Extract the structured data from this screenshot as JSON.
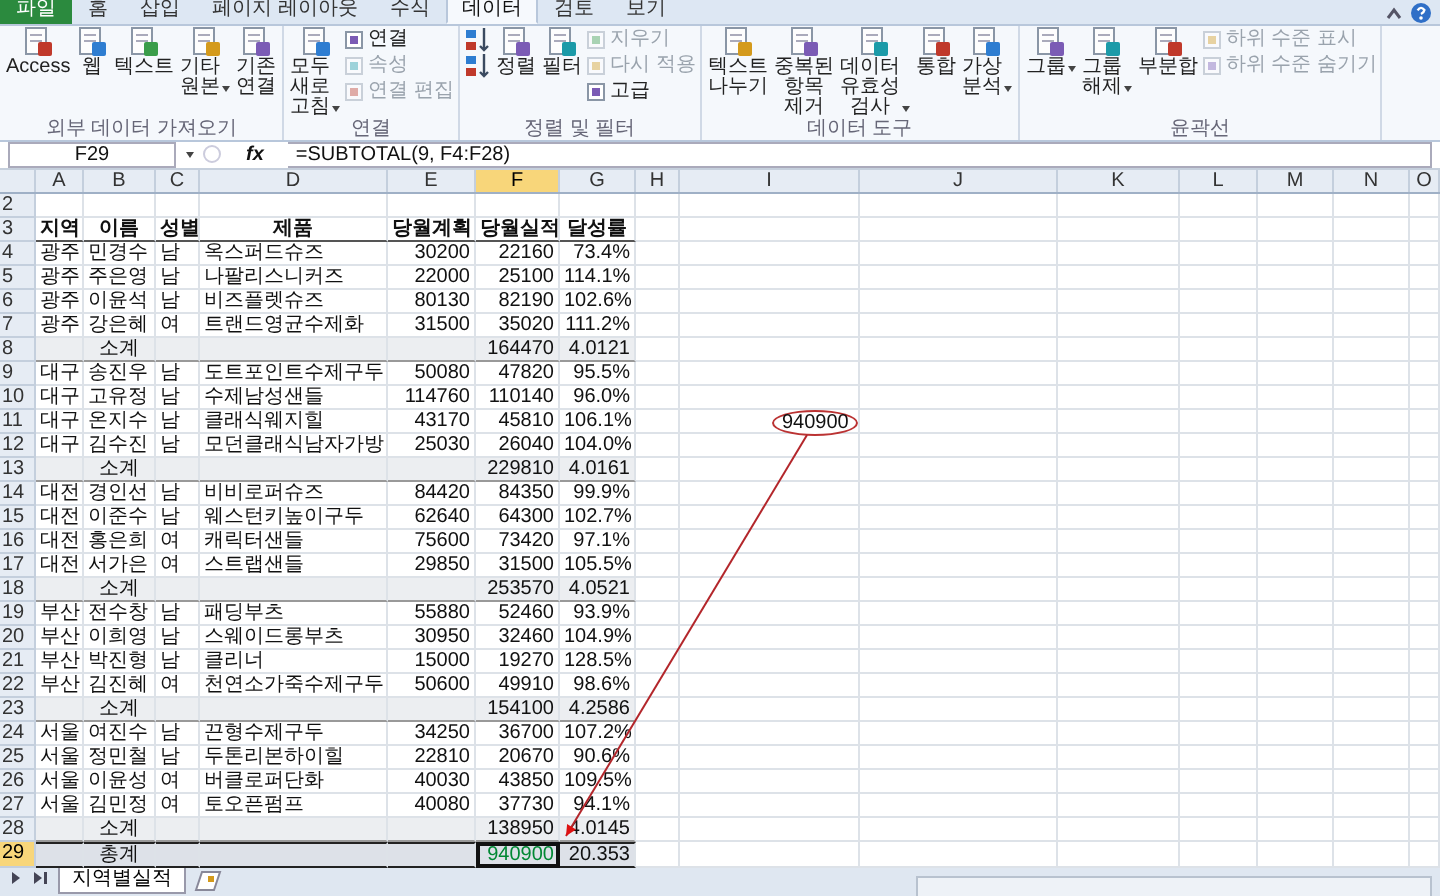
{
  "ribbon_tabs": [
    {
      "label": "파일",
      "kind": "file",
      "selected": false
    },
    {
      "label": "홈",
      "kind": "tab",
      "selected": false
    },
    {
      "label": "삽입",
      "kind": "tab",
      "selected": false
    },
    {
      "label": "페이지 레이아웃",
      "kind": "tab",
      "selected": false
    },
    {
      "label": "수식",
      "kind": "tab",
      "selected": false
    },
    {
      "label": "데이터",
      "kind": "tab",
      "selected": true
    },
    {
      "label": "검토",
      "kind": "tab",
      "selected": false
    },
    {
      "label": "보기",
      "kind": "tab",
      "selected": false
    }
  ],
  "ribbon_groups": [
    {
      "label": "외부 데이터 가져오기",
      "buttons": [
        {
          "label": "Access",
          "kind": "large",
          "dropdown": false,
          "disabled": false
        },
        {
          "label": "웹",
          "kind": "large",
          "dropdown": false,
          "disabled": false
        },
        {
          "label": "텍스트",
          "kind": "large",
          "dropdown": false,
          "disabled": false
        },
        {
          "label": "기타 원본",
          "kind": "large",
          "dropdown": true,
          "disabled": false
        },
        {
          "label": "기존 연결",
          "kind": "large",
          "dropdown": false,
          "disabled": false
        }
      ]
    },
    {
      "label": "연결",
      "buttons": [
        {
          "label": "모두 새로 고침",
          "kind": "large",
          "dropdown": true,
          "disabled": false
        },
        {
          "label": "연결",
          "kind": "small",
          "dropdown": false,
          "disabled": false
        },
        {
          "label": "속성",
          "kind": "small",
          "dropdown": false,
          "disabled": true
        },
        {
          "label": "연결 편집",
          "kind": "small",
          "dropdown": false,
          "disabled": true
        }
      ]
    },
    {
      "label": "정렬 및 필터",
      "buttons": [
        {
          "kind": "sort",
          "dropdown": false,
          "disabled": false
        },
        {
          "kind": "sort",
          "dropdown": false,
          "disabled": false
        },
        {
          "label": "정렬",
          "kind": "large",
          "dropdown": false,
          "disabled": false
        },
        {
          "label": "필터",
          "kind": "large",
          "dropdown": false,
          "disabled": false
        },
        {
          "label": "지우기",
          "kind": "small",
          "dropdown": false,
          "disabled": true
        },
        {
          "label": "다시 적용",
          "kind": "small",
          "dropdown": false,
          "disabled": true
        },
        {
          "label": "고급",
          "kind": "small",
          "dropdown": false,
          "disabled": false
        }
      ]
    },
    {
      "label": "데이터 도구",
      "buttons": [
        {
          "label": "텍스트 나누기",
          "kind": "large",
          "dropdown": false,
          "disabled": false
        },
        {
          "label": "중복된 항목 제거",
          "kind": "large",
          "dropdown": false,
          "disabled": false
        },
        {
          "label": "데이터 유효성 검사",
          "kind": "large",
          "dropdown": true,
          "disabled": false
        },
        {
          "label": "통합",
          "kind": "large",
          "dropdown": false,
          "disabled": false
        },
        {
          "label": "가상 분석",
          "kind": "large",
          "dropdown": true,
          "disabled": false
        }
      ]
    },
    {
      "label": "윤곽선",
      "buttons": [
        {
          "label": "그룹",
          "kind": "large",
          "dropdown": true,
          "disabled": false
        },
        {
          "label": "그룹 해제",
          "kind": "large",
          "dropdown": true,
          "disabled": false
        },
        {
          "label": "부분합",
          "kind": "large",
          "dropdown": false,
          "disabled": false
        },
        {
          "label": "하위 수준 표시",
          "kind": "small",
          "dropdown": false,
          "disabled": true
        },
        {
          "label": "하위 수준 숨기기",
          "kind": "small",
          "dropdown": false,
          "disabled": true
        }
      ]
    }
  ],
  "name_box": "F29",
  "function_label": "fx",
  "formula": "=SUBTOTAL(9, F4:F28)",
  "columns": [
    {
      "label": "A",
      "selected": false
    },
    {
      "label": "B",
      "selected": false
    },
    {
      "label": "C",
      "selected": false
    },
    {
      "label": "D",
      "selected": false
    },
    {
      "label": "E",
      "selected": false
    },
    {
      "label": "F",
      "selected": true
    },
    {
      "label": "G",
      "selected": false
    },
    {
      "label": "H",
      "selected": false
    },
    {
      "label": "I",
      "selected": false
    },
    {
      "label": "J",
      "selected": false
    },
    {
      "label": "K",
      "selected": false
    },
    {
      "label": "L",
      "selected": false
    },
    {
      "label": "M",
      "selected": false
    },
    {
      "label": "N",
      "selected": false
    },
    {
      "label": "O",
      "selected": false
    }
  ],
  "rows": [
    {
      "number": "2",
      "kind": "empty",
      "selected": false
    },
    {
      "number": "3",
      "kind": "header",
      "selected": false,
      "cells": [
        "지역",
        "이름",
        "성별",
        "제품",
        "당월계획",
        "당월실적",
        "달성률"
      ]
    },
    {
      "number": "4",
      "kind": "data",
      "selected": false,
      "cells": [
        "광주",
        "민경수",
        "남",
        "옥스퍼드슈즈",
        "30200",
        "22160",
        "73.4%"
      ]
    },
    {
      "number": "5",
      "kind": "data",
      "selected": false,
      "cells": [
        "광주",
        "주은영",
        "남",
        "나팔리스니커즈",
        "22000",
        "25100",
        "114.1%"
      ]
    },
    {
      "number": "6",
      "kind": "data",
      "selected": false,
      "cells": [
        "광주",
        "이윤석",
        "남",
        "비즈플렛슈즈",
        "80130",
        "82190",
        "102.6%"
      ]
    },
    {
      "number": "7",
      "kind": "data",
      "selected": false,
      "cells": [
        "광주",
        "강은혜",
        "여",
        "트랜드영균수제화",
        "31500",
        "35020",
        "111.2%"
      ]
    },
    {
      "number": "8",
      "kind": "subtotal",
      "selected": false,
      "label": "소계",
      "total": "164470",
      "rate": "4.0121"
    },
    {
      "number": "9",
      "kind": "data",
      "selected": false,
      "cells": [
        "대구",
        "송진우",
        "남",
        "도트포인트수제구두",
        "50080",
        "47820",
        "95.5%"
      ]
    },
    {
      "number": "10",
      "kind": "data",
      "selected": false,
      "cells": [
        "대구",
        "고유정",
        "남",
        "수제남성샌들",
        "114760",
        "110140",
        "96.0%"
      ]
    },
    {
      "number": "11",
      "kind": "data",
      "selected": false,
      "cells": [
        "대구",
        "온지수",
        "남",
        "클래식웨지힐",
        "43170",
        "45810",
        "106.1%"
      ]
    },
    {
      "number": "12",
      "kind": "data",
      "selected": false,
      "cells": [
        "대구",
        "김수진",
        "남",
        "모던클래식남자가방",
        "25030",
        "26040",
        "104.0%"
      ]
    },
    {
      "number": "13",
      "kind": "subtotal",
      "selected": false,
      "label": "소계",
      "total": "229810",
      "rate": "4.0161"
    },
    {
      "number": "14",
      "kind": "data",
      "selected": false,
      "cells": [
        "대전",
        "경인선",
        "남",
        "비비로퍼슈즈",
        "84420",
        "84350",
        "99.9%"
      ]
    },
    {
      "number": "15",
      "kind": "data",
      "selected": false,
      "cells": [
        "대전",
        "이준수",
        "남",
        "웨스턴키높이구두",
        "62640",
        "64300",
        "102.7%"
      ]
    },
    {
      "number": "16",
      "kind": "data",
      "selected": false,
      "cells": [
        "대전",
        "홍은희",
        "여",
        "캐릭터샌들",
        "75600",
        "73420",
        "97.1%"
      ]
    },
    {
      "number": "17",
      "kind": "data",
      "selected": false,
      "cells": [
        "대전",
        "서가은",
        "여",
        "스트랩샌들",
        "29850",
        "31500",
        "105.5%"
      ]
    },
    {
      "number": "18",
      "kind": "subtotal",
      "selected": false,
      "label": "소계",
      "total": "253570",
      "rate": "4.0521"
    },
    {
      "number": "19",
      "kind": "data",
      "selected": false,
      "cells": [
        "부산",
        "전수창",
        "남",
        "패딩부츠",
        "55880",
        "52460",
        "93.9%"
      ]
    },
    {
      "number": "20",
      "kind": "data",
      "selected": false,
      "cells": [
        "부산",
        "이희영",
        "남",
        "스웨이드롱부츠",
        "30950",
        "32460",
        "104.9%"
      ]
    },
    {
      "number": "21",
      "kind": "data",
      "selected": false,
      "cells": [
        "부산",
        "박진형",
        "남",
        "클리너",
        "15000",
        "19270",
        "128.5%"
      ]
    },
    {
      "number": "22",
      "kind": "data",
      "selected": false,
      "cells": [
        "부산",
        "김진혜",
        "여",
        "천연소가죽수제구두",
        "50600",
        "49910",
        "98.6%"
      ]
    },
    {
      "number": "23",
      "kind": "subtotal",
      "selected": false,
      "label": "소계",
      "total": "154100",
      "rate": "4.2586"
    },
    {
      "number": "24",
      "kind": "data",
      "selected": false,
      "cells": [
        "서울",
        "여진수",
        "남",
        "끈형수제구두",
        "34250",
        "36700",
        "107.2%"
      ]
    },
    {
      "number": "25",
      "kind": "data",
      "selected": false,
      "cells": [
        "서울",
        "정민철",
        "남",
        "두톤리본하이힐",
        "22810",
        "20670",
        "90.6%"
      ]
    },
    {
      "number": "26",
      "kind": "data",
      "selected": false,
      "cells": [
        "서울",
        "이윤성",
        "여",
        "버클로퍼단화",
        "40030",
        "43850",
        "109.5%"
      ]
    },
    {
      "number": "27",
      "kind": "data",
      "selected": false,
      "cells": [
        "서울",
        "김민정",
        "여",
        "토오픈펌프",
        "40080",
        "37730",
        "94.1%"
      ]
    },
    {
      "number": "28",
      "kind": "subtotal",
      "selected": false,
      "label": "소계",
      "total": "138950",
      "rate": "4.0145"
    },
    {
      "number": "29",
      "kind": "total",
      "selected": true,
      "label": "총계",
      "total": "940900",
      "rate": "20.353"
    }
  ],
  "callout": {
    "label": "940900"
  },
  "sheet_tabs": [
    {
      "label": "지역별실적",
      "selected": true
    }
  ]
}
